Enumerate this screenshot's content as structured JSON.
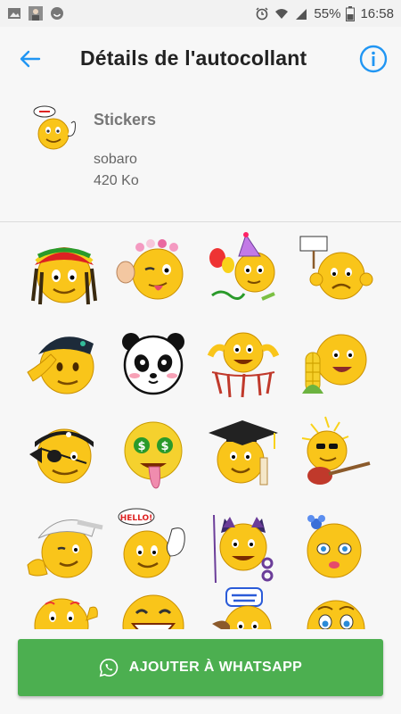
{
  "status_bar": {
    "battery_percent": "55%",
    "time": "16:58",
    "icons": [
      "gallery-icon",
      "avatar-icon",
      "emoji-status-icon",
      "alarm-icon",
      "wifi-icon",
      "signal-icon",
      "battery-icon"
    ]
  },
  "header": {
    "title": "Détails de l'autocollant",
    "back_icon": "arrow-left-icon",
    "info_icon": "info-icon"
  },
  "pack": {
    "name": "Stickers",
    "author": "sobaro",
    "size": "420 Ko"
  },
  "stickers": [
    "rasta-emoji",
    "flower-crown-wink-emoji",
    "party-balloons-emoji",
    "sorry-sign-emoji",
    "saluting-soldier-emoji",
    "panda-face",
    "bunting-banner-emoji",
    "corn-eating-emoji",
    "pirate-emoji",
    "money-eyes-emoji",
    "graduation-emoji",
    "guitar-rock-emoji",
    "baseball-cap-call-emoji",
    "hello-wave-emoji",
    "devil-cat-emoji",
    "flower-girl-emoji",
    "blushing-emoji",
    "laughing-emoji",
    "good-morning-emoji",
    "surprised-emoji"
  ],
  "add_button": {
    "label": "AJOUTER À WHATSAPP",
    "icon": "whatsapp-icon",
    "color": "#4caf50"
  },
  "colors": {
    "accent": "#2196f3",
    "emoji_yellow": "#f9c51a"
  }
}
